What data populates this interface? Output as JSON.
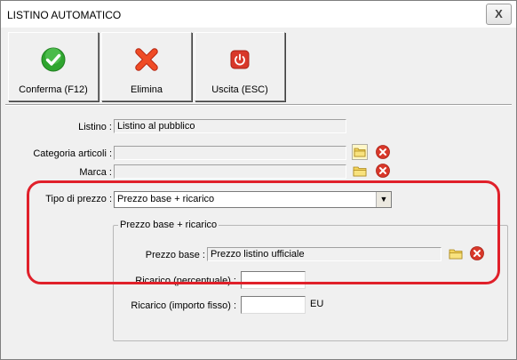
{
  "window": {
    "title": "LISTINO AUTOMATICO",
    "close_glyph": "X"
  },
  "toolbar": {
    "buttons": [
      {
        "label": "Conferma (F12)",
        "icon": "confirm-check-icon",
        "color": "#2fa52f"
      },
      {
        "label": "Elimina",
        "icon": "delete-x-icon",
        "color": "#e23b1f"
      },
      {
        "label": "Uscita (ESC)",
        "icon": "exit-power-icon",
        "color": "#d8382a"
      }
    ]
  },
  "form": {
    "listino": {
      "label": "Listino :",
      "value": "Listino al pubblico"
    },
    "categoria": {
      "label": "Categoria articoli :",
      "value": ""
    },
    "marca": {
      "label": "Marca :",
      "value": ""
    },
    "tipo_prezzo": {
      "label": "Tipo di prezzo :",
      "value": "Prezzo base + ricarico"
    },
    "group": {
      "title": "Prezzo base + ricarico",
      "prezzo_base": {
        "label": "Prezzo base :",
        "value": "Prezzo listino ufficiale"
      },
      "ricarico_percentuale": {
        "label": "Ricarico (percentuale) :",
        "value": ""
      },
      "ricarico_fisso": {
        "label": "Ricarico (importo fisso) :",
        "value": "",
        "unit": "EU"
      }
    }
  },
  "colors": {
    "highlight": "#e0202a",
    "window_bg": "#f0f0f0"
  }
}
